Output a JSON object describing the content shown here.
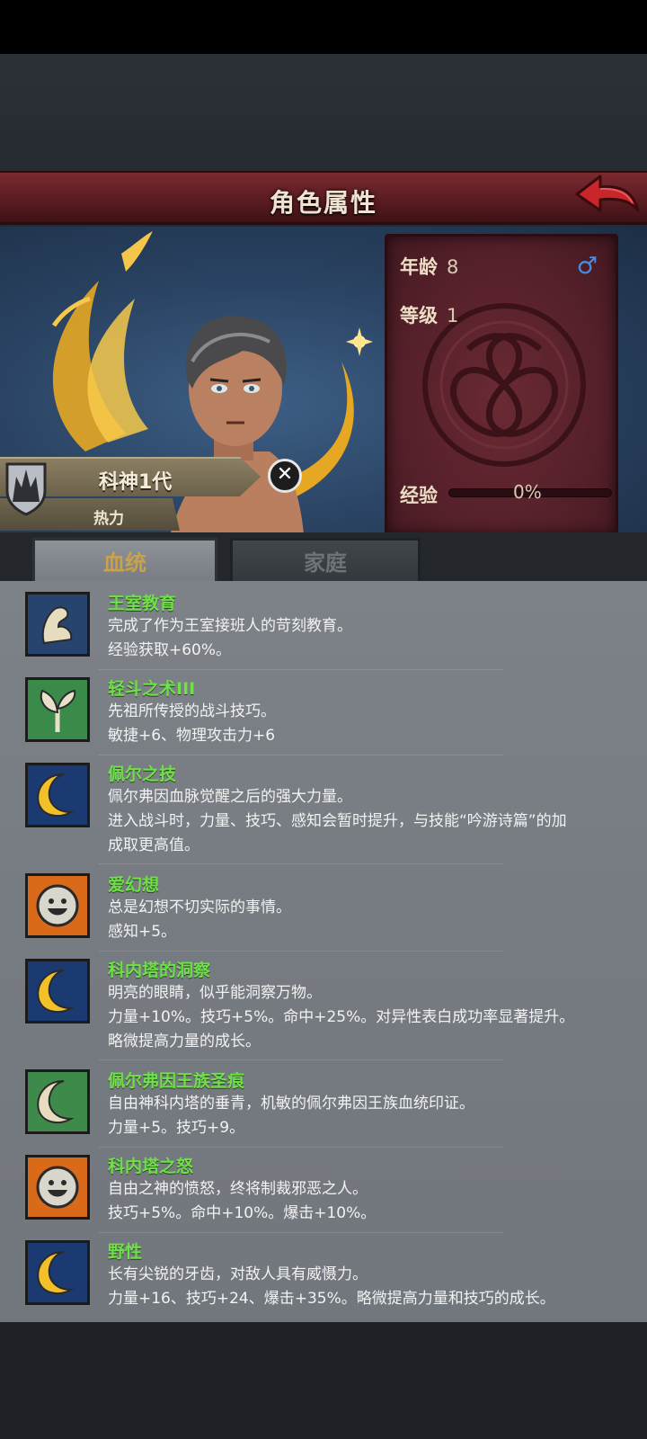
{
  "header": {
    "title": "角色属性"
  },
  "character": {
    "name": "科神1代",
    "status": "热力",
    "age_label": "年龄",
    "age": "8",
    "gender_symbol": "♂",
    "level_label": "等级",
    "level": "1",
    "exp_label": "经验",
    "exp_value": "0%",
    "exp_fraction": 0
  },
  "tabs": [
    {
      "label": "血统",
      "active": true
    },
    {
      "label": "家庭",
      "active": false
    }
  ],
  "traits": [
    {
      "name": "王室教育",
      "icon": "arm-muscle-icon",
      "lines": [
        "完成了作为王室接班人的苛刻教育。",
        "经验获取+60%。"
      ]
    },
    {
      "name": "轻斗之术III",
      "icon": "sprout-icon",
      "lines": [
        "先祖所传授的战斗技巧。",
        "敏捷+6、物理攻击力+6"
      ]
    },
    {
      "name": "佩尔之技",
      "icon": "crescent-moon-icon",
      "lines": [
        "佩尔弗因血脉觉醒之后的强大力量。",
        "进入战斗时，力量、技巧、感知会暂时提升，与技能“吟游诗篇”的加",
        "成取更高值。"
      ]
    },
    {
      "name": "爱幻想",
      "icon": "smiley-face-icon",
      "lines": [
        "总是幻想不切实际的事情。",
        "感知+5。"
      ]
    },
    {
      "name": "科内塔的洞察",
      "icon": "crescent-moon-icon",
      "lines": [
        "明亮的眼睛，似乎能洞察万物。",
        "力量+10%。技巧+5%。命中+25%。对异性表白成功率显著提升。",
        "略微提高力量的成长。"
      ]
    },
    {
      "name": "佩尔弗因王族圣痕",
      "icon": "white-crescent-icon",
      "lines": [
        "自由神科内塔的垂青，机敏的佩尔弗因王族血统印证。",
        "力量+5。技巧+9。"
      ]
    },
    {
      "name": "科内塔之怒",
      "icon": "smiley-face-icon",
      "lines": [
        "自由之神的愤怒，终将制裁邪恶之人。",
        "技巧+5%。命中+10%。爆击+10%。"
      ]
    },
    {
      "name": "野性",
      "icon": "crescent-moon-icon",
      "lines": [
        "长有尖锐的牙齿，对敌人具有威慑力。",
        "力量+16、技巧+24、爆击+35%。略微提高力量和技巧的成长。"
      ]
    }
  ],
  "colors": {
    "trait_name": "#6fe04a",
    "header": "#5a1c22",
    "tab_active_text": "#c9a24a"
  }
}
